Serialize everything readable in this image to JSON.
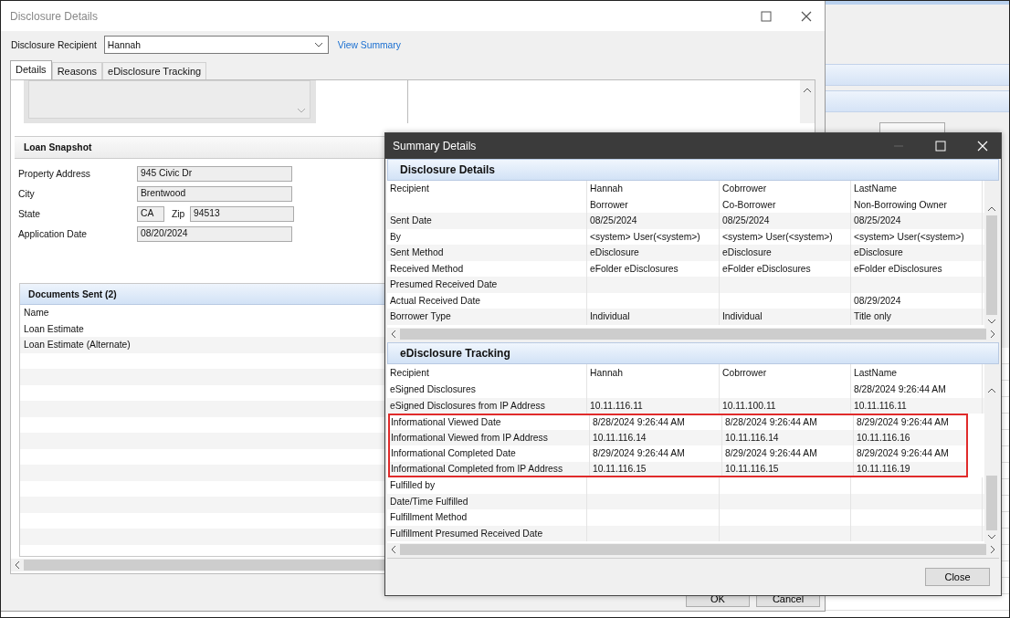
{
  "main_window": {
    "title": "Disclosure Details",
    "recipient_label": "Disclosure Recipient",
    "recipient_value": "Hannah",
    "view_summary_link": "View Summary",
    "tabs": [
      {
        "label": "Details",
        "selected": true
      },
      {
        "label": "Reasons",
        "selected": false
      },
      {
        "label": "eDisclosure Tracking",
        "selected": false
      }
    ],
    "loan_snapshot": {
      "title": "Loan Snapshot",
      "fields": [
        {
          "label": "Property Address",
          "value": "945 Civic Dr"
        },
        {
          "label": "City",
          "value": "Brentwood"
        },
        {
          "label": "State",
          "value": "CA",
          "zip_label": "Zip",
          "zip_value": "94513"
        },
        {
          "label": "Application Date",
          "value": "08/20/2024"
        }
      ]
    },
    "documents_sent": {
      "title": "Documents Sent (2)",
      "column": "Name",
      "rows": [
        "Loan Estimate",
        "Loan Estimate (Alternate)"
      ]
    },
    "buttons": [
      "OK",
      "Cancel"
    ]
  },
  "summary_window": {
    "title": "Summary Details",
    "disclosure_details": {
      "title": "Disclosure Details",
      "rows": [
        {
          "label": "Recipient",
          "col_1": "Hannah",
          "col_2": "Cobrrower",
          "col_3": "LastName"
        },
        {
          "col_1": "Borrower",
          "col_2": "Co-Borrower",
          "col_3": "Non-Borrowing Owner"
        },
        {
          "label": "Sent Date",
          "col_1": "08/25/2024",
          "col_2": "08/25/2024",
          "col_3": "08/25/2024"
        },
        {
          "label": "By",
          "col_1": "<system> User(<system>)",
          "col_2": "<system> User(<system>)",
          "col_3": "<system> User(<system>)"
        },
        {
          "label": "Sent Method",
          "col_1": "eDisclosure",
          "col_2": "eDisclosure",
          "col_3": "eDisclosure"
        },
        {
          "label": "Received Method",
          "col_1": "eFolder eDisclosures",
          "col_2": "eFolder eDisclosures",
          "col_3": "eFolder eDisclosures"
        },
        {
          "label": "Presumed Received Date"
        },
        {
          "label": "Actual Received Date",
          "col_3": "08/29/2024"
        },
        {
          "label": "Borrower Type",
          "col_1": "Individual",
          "col_2": "Individual",
          "col_3": "Title only"
        }
      ]
    },
    "tracking": {
      "title": "eDisclosure Tracking",
      "rows": [
        {
          "label": "Recipient",
          "col_1": "Hannah",
          "col_2": "Cobrrower",
          "col_3": "LastName",
          "highlighted": false
        },
        {
          "label": "eSigned Disclosures",
          "col_3": "8/28/2024 9:26:44 AM",
          "highlighted": false
        },
        {
          "label": "eSigned Disclosures from IP Address",
          "col_1": "10.11.116.11",
          "col_2": "10.11.100.11",
          "col_3": "10.11.116.11",
          "highlighted": false
        },
        {
          "label": "Informational Viewed Date",
          "col_1": "8/28/2024 9:26:44 AM",
          "col_2": "8/28/2024 9:26:44 AM",
          "col_3": "8/29/2024 9:26:44 AM",
          "highlighted": true
        },
        {
          "label": "Informational Viewed from IP Address",
          "col_1": "10.11.116.14",
          "col_2": "10.11.116.14",
          "col_3": "10.11.116.16",
          "highlighted": true
        },
        {
          "label": "Informational Completed Date",
          "col_1": "8/29/2024 9:26:44 AM",
          "col_2": "8/29/2024 9:26:44 AM",
          "col_3": "8/29/2024 9:26:44 AM",
          "highlighted": true
        },
        {
          "label": "Informational Completed from IP Address",
          "col_1": "10.11.116.15",
          "col_2": "10.11.116.15",
          "col_3": "10.11.116.19",
          "highlighted": true
        },
        {
          "label": "Fulfilled by",
          "highlighted": false
        },
        {
          "label": "Date/Time Fulfilled",
          "highlighted": false
        },
        {
          "label": "Fulfillment Method",
          "highlighted": false
        },
        {
          "label": "Fulfillment Presumed Received Date",
          "highlighted": false
        }
      ]
    },
    "close_button": "Close"
  }
}
